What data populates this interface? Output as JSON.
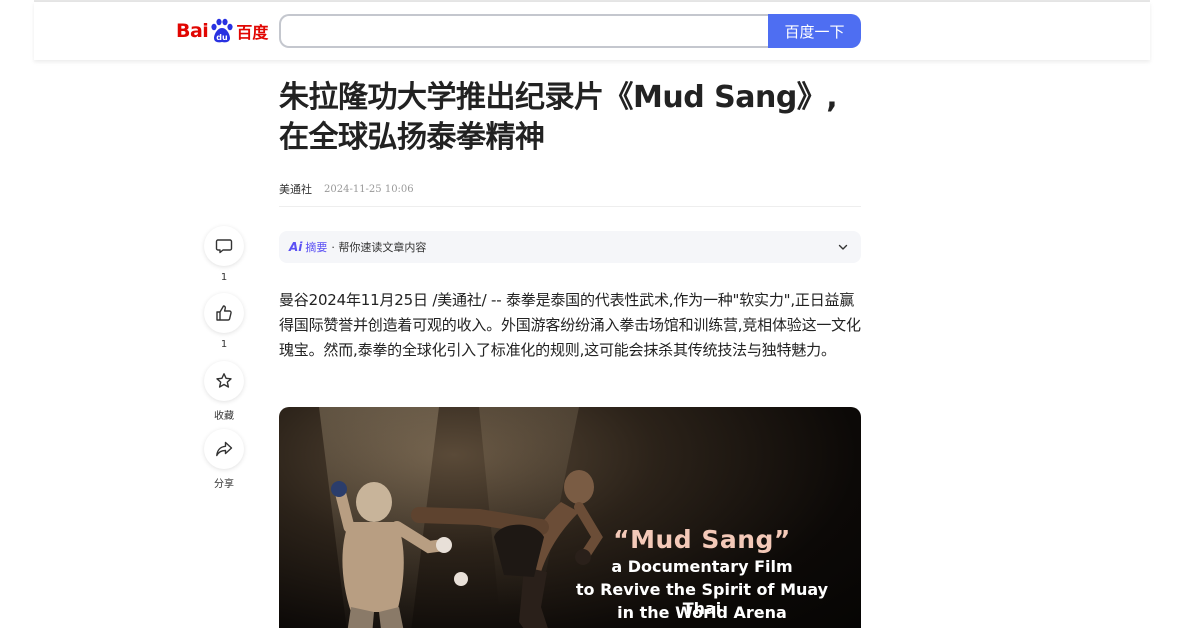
{
  "header": {
    "logo_text_bai": "Bai",
    "logo_text_du": "du",
    "logo_text_cn": "百度",
    "search_value": "",
    "search_button_label": "百度一下"
  },
  "article": {
    "title_line1": "朱拉隆功大学推出纪录片《Mud Sang》,",
    "title_line2": "在全球弘扬泰拳精神",
    "source": "美通社",
    "time": "2024-11-25 10:06",
    "ai_summary": {
      "logo": "Ai",
      "label": "摘要",
      "description": "· 帮你速读文章内容"
    },
    "paragraph": "曼谷2024年11月25日 /美通社/ -- 泰拳是泰国的代表性武术,作为一种\"软实力\",正日益赢得国际赞誉并创造着可观的收入。外国游客纷纷涌入拳击场馆和训练营,竞相体验这一文化瑰宝。然而,泰拳的全球化引入了标准化的规则,这可能会抹杀其传统技法与独特魅力。",
    "image_caption": {
      "line1": "“Mud Sang”",
      "line2": "a Documentary Film",
      "line3": "to Revive the Spirit of Muay Thai",
      "line4": "in the World Arena"
    }
  },
  "sidebar": {
    "comment_count": "1",
    "like_count": "1",
    "favorite_label": "收藏",
    "share_label": "分享"
  },
  "colors": {
    "brand_red": "#e10602",
    "search_blue": "#4e6ef2",
    "ai_purple": "#5a4ff4"
  }
}
